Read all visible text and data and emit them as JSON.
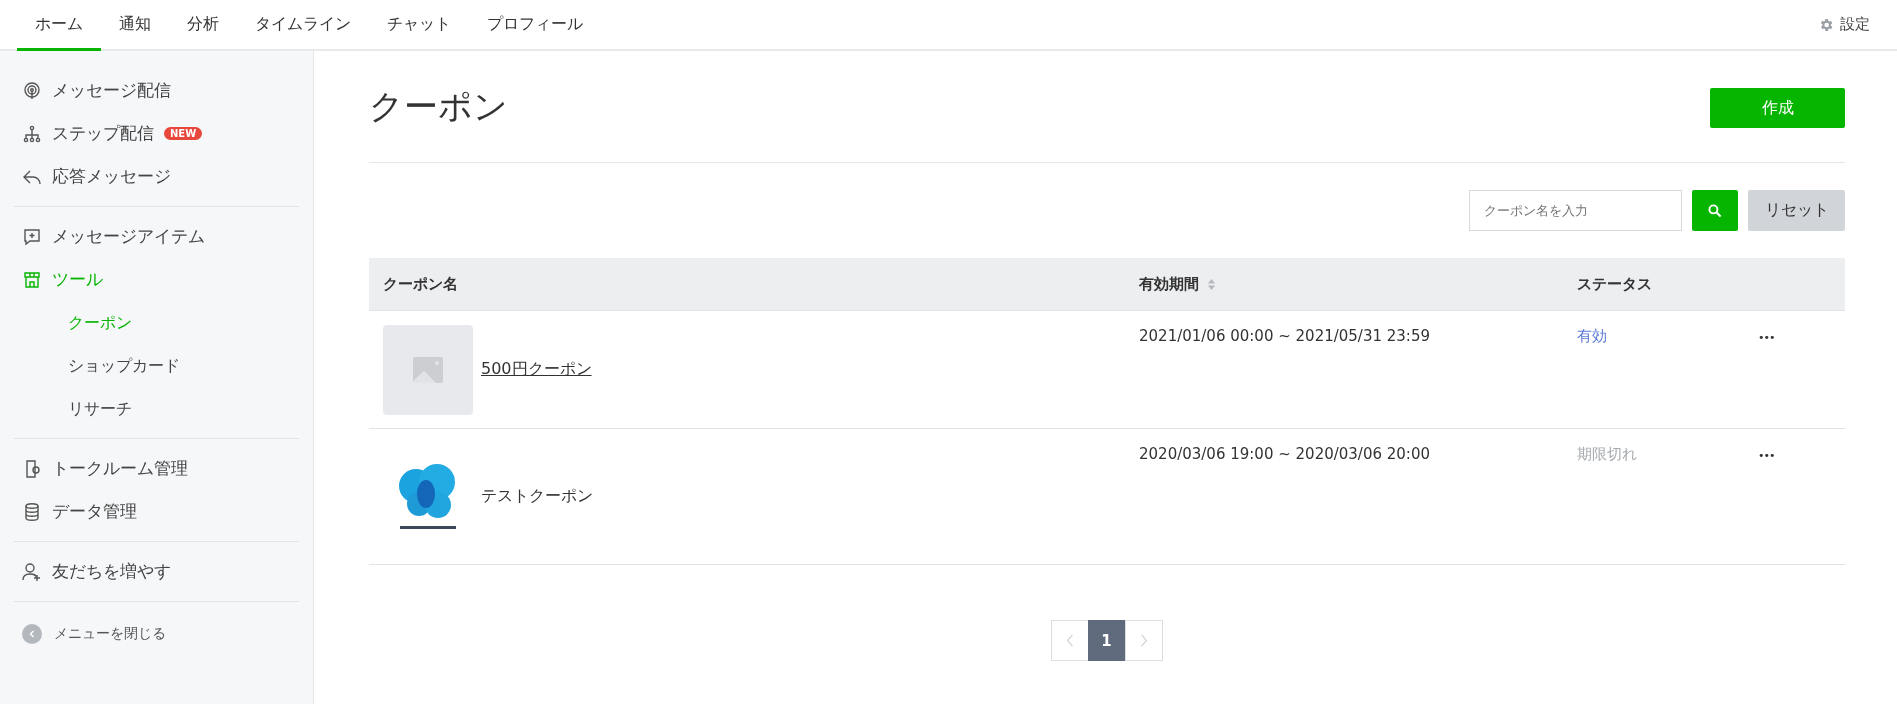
{
  "top_tabs": [
    {
      "label": "ホーム",
      "selected": true
    },
    {
      "label": "通知",
      "selected": false
    },
    {
      "label": "分析",
      "selected": false
    },
    {
      "label": "タイムライン",
      "selected": false
    },
    {
      "label": "チャット",
      "selected": false
    },
    {
      "label": "プロフィール",
      "selected": false
    }
  ],
  "settings": {
    "label": "設定"
  },
  "sidebar": {
    "groups": [
      [
        {
          "label": "メッセージ配信",
          "selected": false
        },
        {
          "label": "ステップ配信",
          "selected": false,
          "badge": "NEW"
        },
        {
          "label": "応答メッセージ",
          "selected": false
        }
      ],
      [
        {
          "label": "メッセージアイテム",
          "selected": false
        },
        {
          "label": "ツール",
          "selected": true,
          "children": [
            {
              "label": "クーポン",
              "selected": true
            },
            {
              "label": "ショップカード",
              "selected": false
            },
            {
              "label": "リサーチ",
              "selected": false
            }
          ]
        }
      ],
      [
        {
          "label": "トークルーム管理",
          "selected": false
        },
        {
          "label": "データ管理",
          "selected": false
        }
      ],
      [
        {
          "label": "友だちを増やす",
          "selected": false
        }
      ]
    ],
    "collapse": "メニューを閉じる"
  },
  "page": {
    "title": "クーポン",
    "create_button": "作成",
    "search": {
      "placeholder": "クーポン名を入力"
    },
    "reset_button": "リセット"
  },
  "table": {
    "columns": [
      {
        "label": "クーポン名",
        "sortable": false
      },
      {
        "label": "有効期間",
        "sortable": true
      },
      {
        "label": "ステータス",
        "sortable": false
      }
    ],
    "rows": [
      {
        "name": "500円クーポン",
        "link": true,
        "period": "2021/01/06 00:00 ~ 2021/05/31 23:59",
        "status": "有効",
        "kind": "active",
        "menu": "•••"
      },
      {
        "name": "テストクーポン",
        "link": false,
        "period": "2020/03/06 19:00 ~ 2020/03/06 20:00",
        "status": "期限切れ",
        "kind": "expired",
        "menu": "•••"
      }
    ]
  },
  "pagination": {
    "pages": [
      {
        "label": "1",
        "selected": true
      }
    ],
    "prev_disabled": true,
    "next_disabled": true
  }
}
